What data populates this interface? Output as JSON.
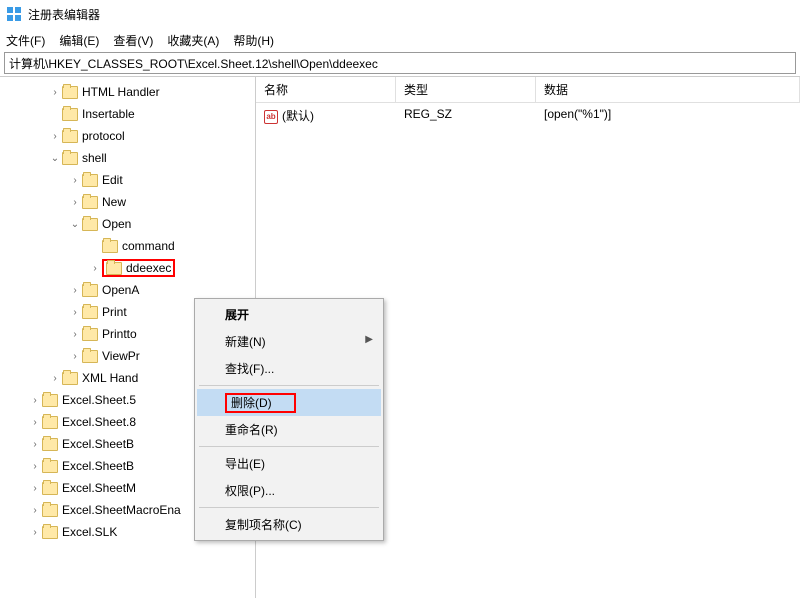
{
  "window": {
    "title": "注册表编辑器"
  },
  "menu": {
    "file": "文件(F)",
    "edit": "编辑(E)",
    "view": "查看(V)",
    "fav": "收藏夹(A)",
    "help": "帮助(H)"
  },
  "address": "计算机\\HKEY_CLASSES_ROOT\\Excel.Sheet.12\\shell\\Open\\ddeexec",
  "cols": {
    "name": "名称",
    "type": "类型",
    "data": "数据"
  },
  "rows": [
    {
      "name": "(默认)",
      "type": "REG_SZ",
      "data": "[open(\"%1\")]"
    }
  ],
  "tree": {
    "html": "HTML Handler",
    "insertable": "Insertable",
    "protocol": "protocol",
    "shell": "shell",
    "edit": "Edit",
    "new": "New",
    "open": "Open",
    "command": "command",
    "ddeexec": "ddeexec",
    "opena": "OpenA",
    "print": "Print",
    "printto": "Printto",
    "viewpr": "ViewPr",
    "xmlhand": "XML Hand",
    "sheet5": "Excel.Sheet.5",
    "sheet8": "Excel.Sheet.8",
    "sheetb1": "Excel.SheetB",
    "sheetb2": "Excel.SheetB",
    "sheetm": "Excel.SheetM",
    "macro": "Excel.SheetMacroEna",
    "slk": "Excel.SLK"
  },
  "ctx": {
    "expand": "展开",
    "new": "新建(N)",
    "find": "查找(F)...",
    "delete": "删除(D)",
    "rename": "重命名(R)",
    "export": "导出(E)",
    "perm": "权限(P)...",
    "copy": "复制项名称(C)"
  }
}
